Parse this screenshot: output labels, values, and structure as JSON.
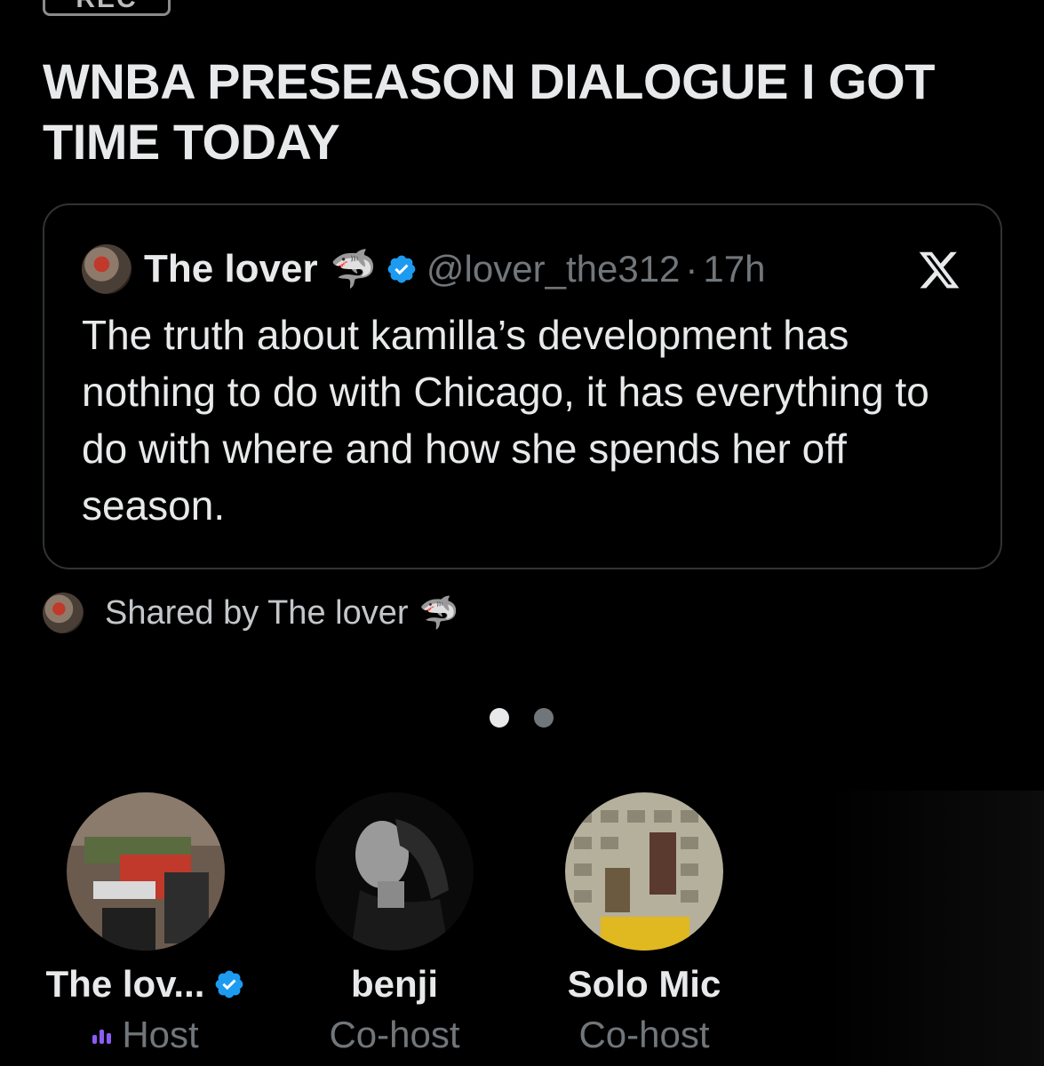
{
  "rec_label": "REC",
  "space": {
    "title": "WNBA PRESEASON DIALOGUE I GOT TIME TODAY"
  },
  "tweet": {
    "author_name": "The lover",
    "author_emoji": "🦈",
    "handle": "@lover_the312",
    "separator": "·",
    "time": "17h",
    "text": "The truth about kamilla’s development has nothing to do with Chicago, it has everything to do with where and how she spends her off season."
  },
  "shared": {
    "text": "Shared by The lover",
    "emoji": "🦈"
  },
  "pager": {
    "pages": 2,
    "active_index": 0
  },
  "speakers": [
    {
      "name": "The lov...",
      "role": "Host",
      "verified": true
    },
    {
      "name": "benji",
      "role": "Co-host",
      "verified": false
    },
    {
      "name": "Solo Mic",
      "role": "Co-host",
      "verified": false
    }
  ],
  "colors": {
    "background": "#000000",
    "text_primary": "#e7e9ea",
    "text_secondary": "#71767b",
    "verified_blue": "#1d9bf0",
    "host_bars": "#8b5cf6"
  }
}
